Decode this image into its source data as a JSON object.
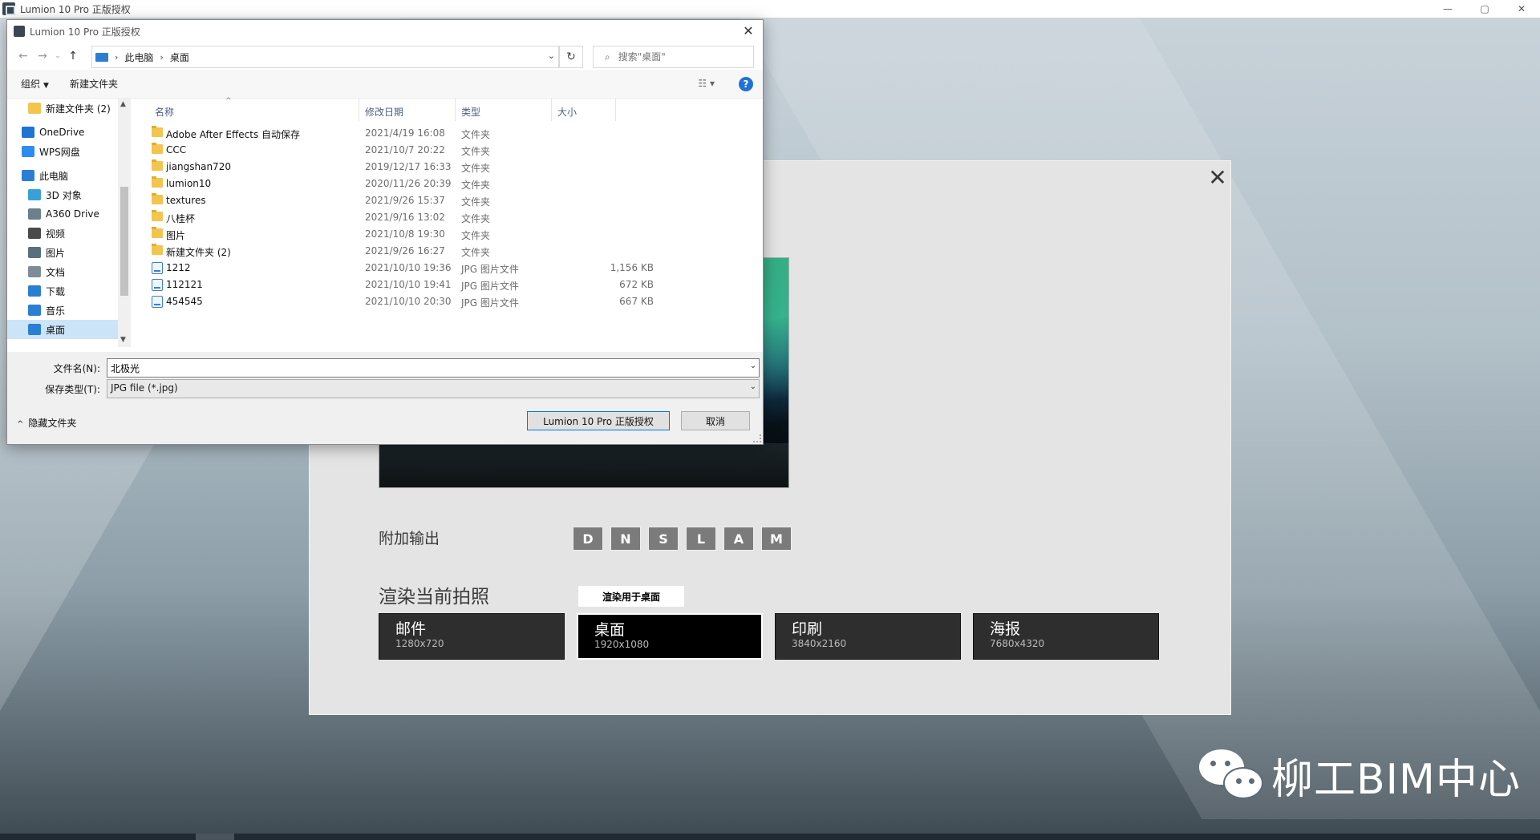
{
  "app": {
    "title": "Lumion 10 Pro 正版授权",
    "window_controls": [
      "—",
      "▢",
      "✕"
    ]
  },
  "render_panel": {
    "close_glyph": "✕",
    "extra_output_label": "附加输出",
    "extra_buttons": [
      "D",
      "N",
      "S",
      "L",
      "A",
      "M"
    ],
    "render_label": "渲染当前拍照",
    "tooltip": "渲染用于桌面",
    "sizes": [
      {
        "name": "邮件",
        "res": "1280x720",
        "selected": false
      },
      {
        "name": "桌面",
        "res": "1920x1080",
        "selected": true
      },
      {
        "name": "印刷",
        "res": "3840x2160",
        "selected": false
      },
      {
        "name": "海报",
        "res": "7680x4320",
        "selected": false
      }
    ]
  },
  "watermark": {
    "text": "柳工BIM中心",
    "icon": "wechat-icon"
  },
  "dialog": {
    "title": "Lumion 10 Pro 正版授权",
    "address": {
      "crumbs": [
        "此电脑",
        "桌面"
      ],
      "separator": "›"
    },
    "search_placeholder": "搜索\"桌面\"",
    "toolbar": {
      "organize": "组织",
      "new_folder": "新建文件夹",
      "help": "?"
    },
    "nav_items": [
      {
        "label": "新建文件夹 (2)",
        "icon": "folder-icon",
        "color": "#f3c54e",
        "indent": 26,
        "selected": false
      },
      {
        "label": "OneDrive",
        "icon": "cloud-icon",
        "color": "#1f73d1",
        "indent": 18,
        "selected": false
      },
      {
        "label": "WPS网盘",
        "icon": "cloud-icon",
        "color": "#2d8cf0",
        "indent": 18,
        "selected": false
      },
      {
        "label": "此电脑",
        "icon": "computer-icon",
        "color": "#2a7fd4",
        "indent": 18,
        "selected": false
      },
      {
        "label": "3D 对象",
        "icon": "cube-icon",
        "color": "#39a0d8",
        "indent": 26,
        "selected": false
      },
      {
        "label": "A360 Drive",
        "icon": "drive-icon",
        "color": "#6b7f8c",
        "indent": 26,
        "selected": false
      },
      {
        "label": "视频",
        "icon": "video-icon",
        "color": "#4a4a4a",
        "indent": 26,
        "selected": false
      },
      {
        "label": "图片",
        "icon": "image-icon",
        "color": "#5a6f7d",
        "indent": 26,
        "selected": false
      },
      {
        "label": "文档",
        "icon": "document-icon",
        "color": "#7d8c96",
        "indent": 26,
        "selected": false
      },
      {
        "label": "下载",
        "icon": "download-icon",
        "color": "#2a7fd4",
        "indent": 26,
        "selected": false
      },
      {
        "label": "音乐",
        "icon": "music-icon",
        "color": "#2a7fd4",
        "indent": 26,
        "selected": false
      },
      {
        "label": "桌面",
        "icon": "desktop-icon",
        "color": "#2a7fd4",
        "indent": 26,
        "selected": true
      }
    ],
    "columns": {
      "name": "名称",
      "date": "修改日期",
      "type": "类型",
      "size": "大小"
    },
    "files": [
      {
        "name": "Adobe After Effects 自动保存",
        "date": "2021/4/19 16:08",
        "type": "文件夹",
        "size": "",
        "kind": "folder"
      },
      {
        "name": "CCC",
        "date": "2021/10/7 20:22",
        "type": "文件夹",
        "size": "",
        "kind": "folder"
      },
      {
        "name": "jiangshan720",
        "date": "2019/12/17 16:33",
        "type": "文件夹",
        "size": "",
        "kind": "folder"
      },
      {
        "name": "lumion10",
        "date": "2020/11/26 20:39",
        "type": "文件夹",
        "size": "",
        "kind": "folder"
      },
      {
        "name": "textures",
        "date": "2021/9/26 15:37",
        "type": "文件夹",
        "size": "",
        "kind": "folder"
      },
      {
        "name": "八桂杯",
        "date": "2021/9/16 13:02",
        "type": "文件夹",
        "size": "",
        "kind": "folder"
      },
      {
        "name": "图片",
        "date": "2021/10/8 19:30",
        "type": "文件夹",
        "size": "",
        "kind": "folder"
      },
      {
        "name": "新建文件夹 (2)",
        "date": "2021/9/26 16:27",
        "type": "文件夹",
        "size": "",
        "kind": "folder"
      },
      {
        "name": "1212",
        "date": "2021/10/10 19:36",
        "type": "JPG 图片文件",
        "size": "1,156 KB",
        "kind": "jpg"
      },
      {
        "name": "112121",
        "date": "2021/10/10 19:41",
        "type": "JPG 图片文件",
        "size": "672 KB",
        "kind": "jpg"
      },
      {
        "name": "454545",
        "date": "2021/10/10 20:30",
        "type": "JPG 图片文件",
        "size": "667 KB",
        "kind": "jpg"
      }
    ],
    "filename_label": "文件名(N):",
    "filename_value": "北极光",
    "filetype_label": "保存类型(T):",
    "filetype_value": "JPG file (*.jpg)",
    "hide_folders": "隐藏文件夹",
    "save_button": "Lumion 10 Pro 正版授权",
    "cancel_button": "取消"
  }
}
